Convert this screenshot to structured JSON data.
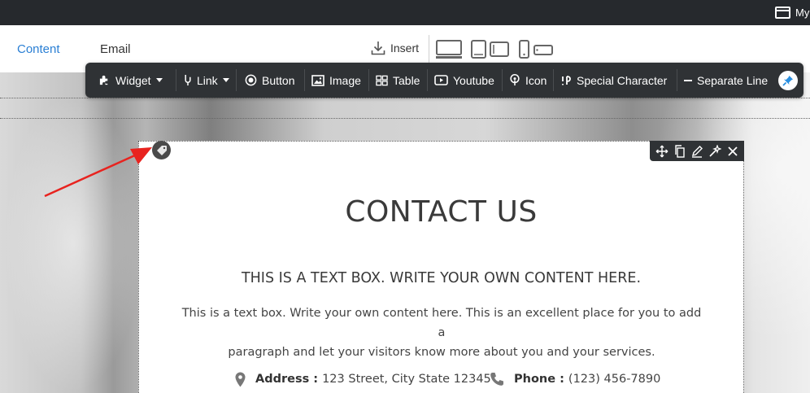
{
  "topbar": {
    "site_label": "My"
  },
  "tabs": [
    {
      "label": "Content",
      "active": true
    },
    {
      "label": "Email",
      "active": false
    }
  ],
  "header": {
    "insert_label": "Insert"
  },
  "toolbar": {
    "items": [
      {
        "label": "Widget",
        "icon": "puzzle-icon",
        "dropdown": true
      },
      {
        "label": "Link",
        "icon": "link-icon",
        "dropdown": true
      },
      {
        "label": "Button",
        "icon": "radio-button-icon"
      },
      {
        "label": "Image",
        "icon": "image-icon"
      },
      {
        "label": "Table",
        "icon": "table-icon"
      },
      {
        "label": "Youtube",
        "icon": "youtube-icon"
      },
      {
        "label": "Icon",
        "icon": "map-pin-icon"
      },
      {
        "label": "Special Character",
        "icon": "special-character-icon"
      },
      {
        "label": "Separate Line",
        "icon": "separator-icon"
      }
    ],
    "pin_icon": "pin-icon"
  },
  "card_tools": [
    "move-icon",
    "copy-icon",
    "edit-icon",
    "magic-wand-icon",
    "close-icon"
  ],
  "content": {
    "title": "CONTACT US",
    "subtitle": "THIS IS A TEXT BOX. WRITE YOUR OWN CONTENT HERE.",
    "paragraph_line1": "This is a text box. Write your own content here. This is an excellent place for you to add a",
    "paragraph_line2": "paragraph and let your visitors know more about you and your services.",
    "address_label": "Address :",
    "address_value": "123 Street, City State 12345",
    "phone_label": "Phone :",
    "phone_value": "(123) 456-7890"
  },
  "colors": {
    "accent": "#2a7fd4",
    "toolbar_bg": "#2f3235",
    "topbar_bg": "#26292d",
    "arrow": "#e8231f"
  }
}
